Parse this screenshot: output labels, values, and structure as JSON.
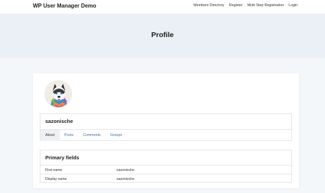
{
  "header": {
    "site_title": "WP User Manager Demo",
    "nav": [
      "Members Directory",
      "Register",
      "Multi Step Registration",
      "Login"
    ]
  },
  "page": {
    "title": "Profile"
  },
  "profile": {
    "username": "sazonische",
    "avatar_icon": "husky-dog-avatar",
    "tabs": [
      {
        "label": "About",
        "active": true
      },
      {
        "label": "Posts",
        "active": false
      },
      {
        "label": "Comments",
        "active": false
      },
      {
        "label": "Groups",
        "active": false
      }
    ]
  },
  "fields": {
    "title": "Primary fields",
    "rows": [
      {
        "label": "First name",
        "value": "sazonische"
      },
      {
        "label": "Display name",
        "value": "sazonische"
      }
    ]
  }
}
